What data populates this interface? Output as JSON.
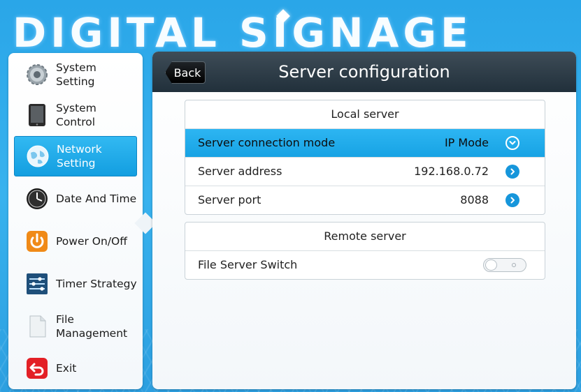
{
  "branding": {
    "logo_text": "DIGITAL SIGNAGE"
  },
  "sidebar": {
    "items": [
      {
        "label": "System Setting",
        "icon": "gear-icon"
      },
      {
        "label": "System Control",
        "icon": "tablet-icon"
      },
      {
        "label": "Network Setting",
        "icon": "globe-icon",
        "active": true
      },
      {
        "label": "Date And Time",
        "icon": "clock-icon"
      },
      {
        "label": "Power On/Off",
        "icon": "power-icon"
      },
      {
        "label": "Timer Strategy",
        "icon": "sliders-icon"
      },
      {
        "label": "File Management",
        "icon": "file-icon"
      },
      {
        "label": "Exit",
        "icon": "exit-icon"
      }
    ]
  },
  "header": {
    "back_label": "Back",
    "title": "Server configuration"
  },
  "local_server": {
    "title": "Local server",
    "rows": [
      {
        "label": "Server connection mode",
        "value": "IP Mode",
        "control": "chevron-down-icon",
        "highlighted": true
      },
      {
        "label": "Server address",
        "value": "192.168.0.72",
        "control": "chevron-right-icon"
      },
      {
        "label": "Server port",
        "value": "8088",
        "control": "chevron-right-icon"
      }
    ]
  },
  "remote_server": {
    "title": "Remote server",
    "rows": [
      {
        "label": "File Server Switch",
        "control": "toggle",
        "enabled": false
      }
    ]
  },
  "colors": {
    "accent": "#17a3e4",
    "header_dark": "#2a3842",
    "background": "#2aa6e8"
  }
}
